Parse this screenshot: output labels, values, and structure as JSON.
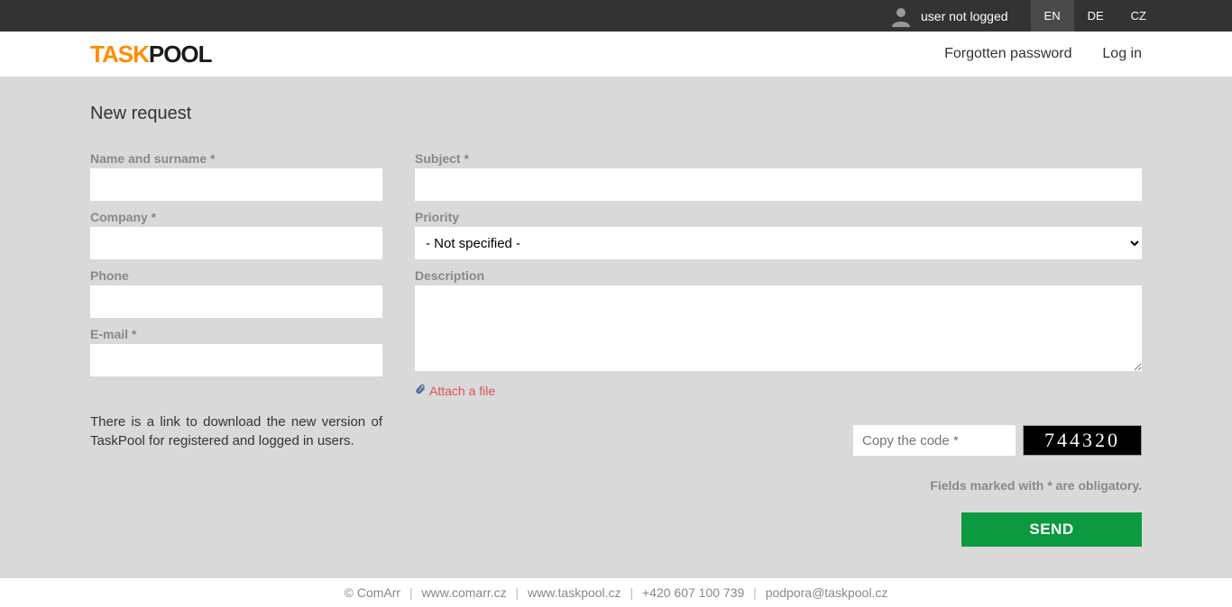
{
  "topbar": {
    "user_status": "user not logged",
    "languages": [
      {
        "code": "EN",
        "active": true
      },
      {
        "code": "DE",
        "active": false
      },
      {
        "code": "CZ",
        "active": false
      }
    ]
  },
  "header": {
    "logo_task": "TASK",
    "logo_pool": "POOL",
    "forgotten_password": "Forgotten password",
    "log_in": "Log in"
  },
  "page": {
    "title": "New request"
  },
  "form": {
    "name_label": "Name and surname *",
    "name_value": "",
    "company_label": "Company *",
    "company_value": "",
    "phone_label": "Phone",
    "phone_value": "",
    "email_label": "E-mail *",
    "email_value": "",
    "subject_label": "Subject *",
    "subject_value": "",
    "priority_label": "Priority",
    "priority_value": "- Not specified -",
    "description_label": "Description",
    "description_value": "",
    "attach_label": "Attach a file",
    "captcha_placeholder": "Copy the code *",
    "captcha_code": "744320",
    "obligatory_text": "Fields marked with * are obligatory.",
    "send_label": "SEND"
  },
  "info_text": "There is a link to download the new version of TaskPool for registered and logged in users.",
  "footer": {
    "copyright": "© ComArr",
    "link1": "www.comarr.cz",
    "link2": "www.taskpool.cz",
    "phone": "+420 607 100 739",
    "email": "podpora@taskpool.cz"
  }
}
